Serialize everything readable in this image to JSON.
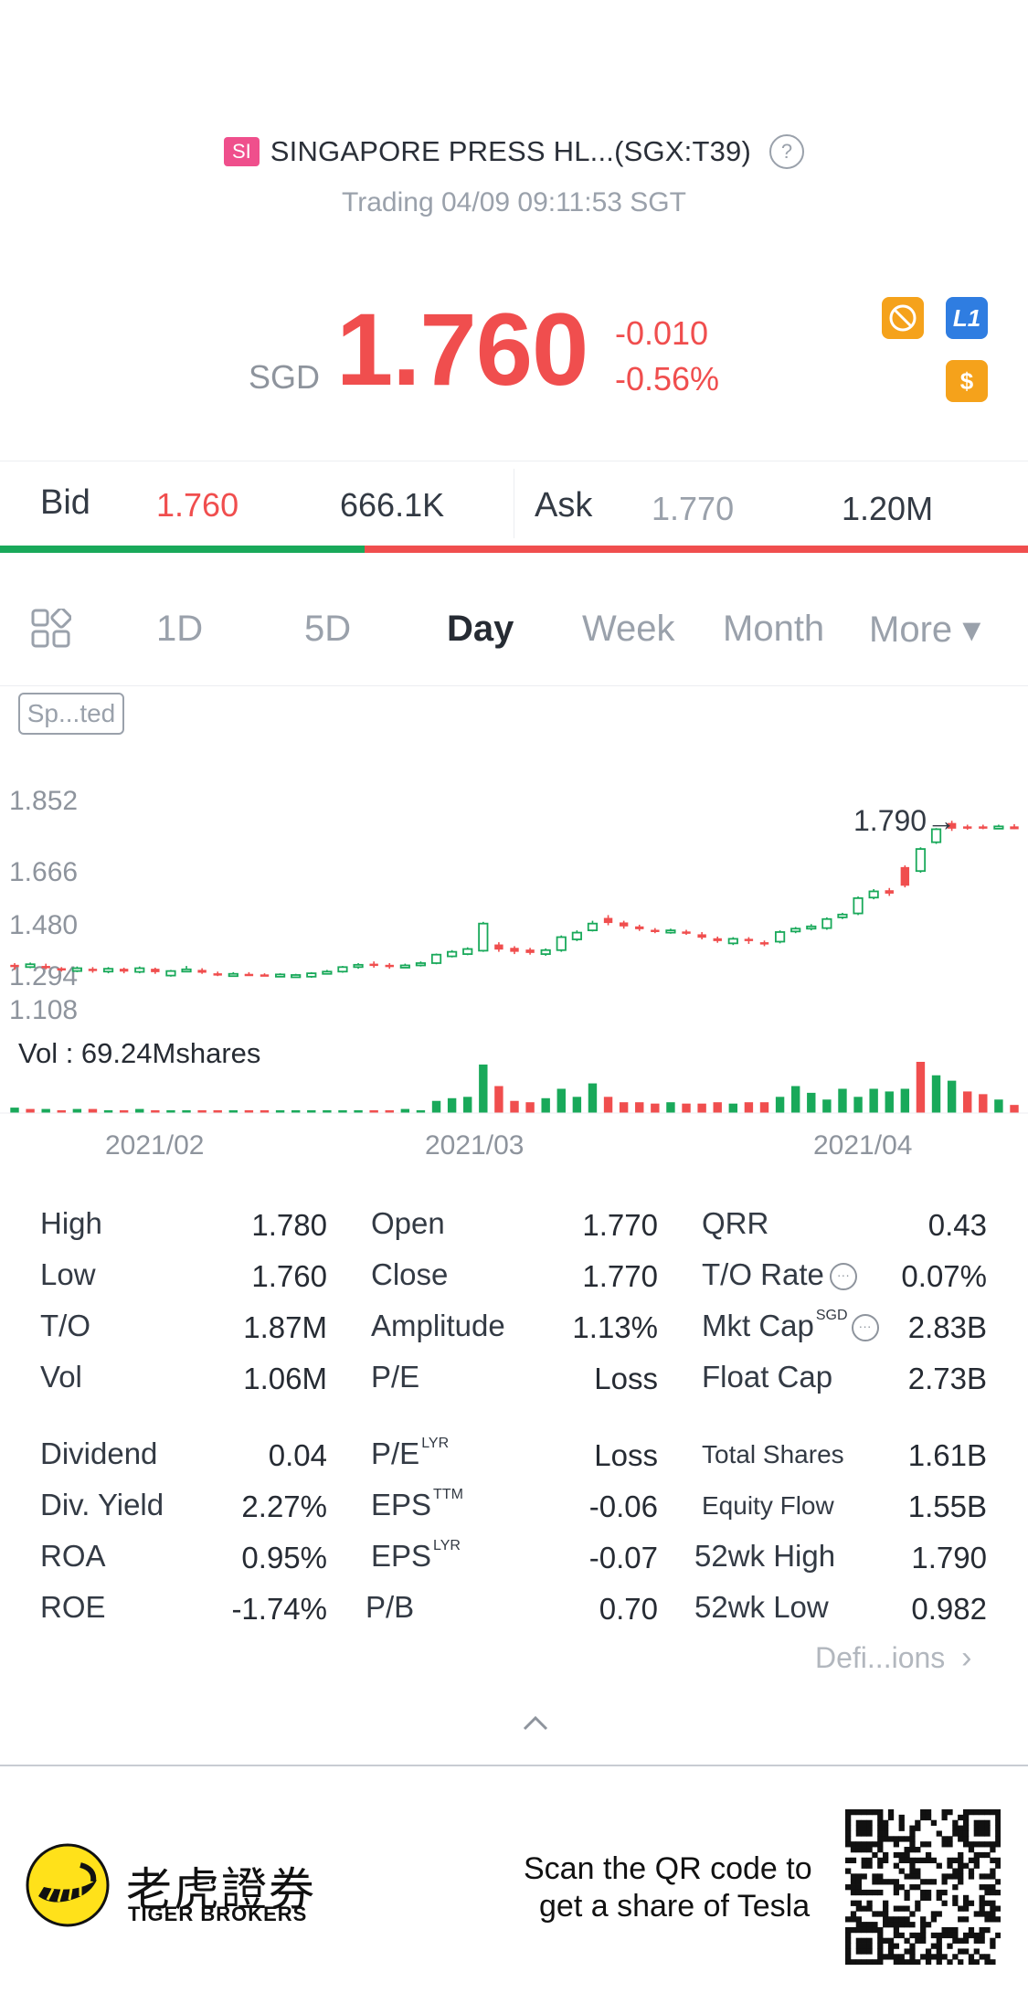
{
  "header": {
    "market_badge": "SI",
    "title": "SINGAPORE PRESS HL...(SGX:T39)",
    "status": "Trading 04/09 09:11:53 SGT"
  },
  "quote": {
    "currency": "SGD",
    "price": "1.760",
    "change": "-0.010",
    "change_pct": "-0.56%",
    "badges": {
      "l1": "L1",
      "dollar": "$"
    }
  },
  "bid_ask": {
    "bid_label": "Bid",
    "bid_price": "1.760",
    "bid_size": "666.1K",
    "ask_label": "Ask",
    "ask_price": "1.770",
    "ask_size": "1.20M",
    "bid_ratio": 0.355
  },
  "tabs": [
    {
      "label": "1D"
    },
    {
      "label": "5D"
    },
    {
      "label": "Day",
      "active": true
    },
    {
      "label": "Week"
    },
    {
      "label": "Month"
    },
    {
      "label": "More ▾"
    }
  ],
  "chart_controls": {
    "split_label": "Sp...ted"
  },
  "chart_data": {
    "type": "candlestick",
    "price_ticks": [
      "1.852",
      "1.666",
      "1.480",
      "1.294",
      "1.108"
    ],
    "ylim": [
      1.108,
      1.852
    ],
    "last_marker": "1.790",
    "x_ticks": [
      "2021/02",
      "2021/03",
      "2021/04"
    ],
    "volume_label": "Vol  : 69.24Mshares",
    "up_color": "#19a95a",
    "down_color": "#f04e4e",
    "candles": [
      {
        "o": 1.28,
        "c": 1.272,
        "h": 1.286,
        "l": 1.262
      },
      {
        "o": 1.272,
        "c": 1.282,
        "h": 1.288,
        "l": 1.268
      },
      {
        "o": 1.276,
        "c": 1.27,
        "h": 1.284,
        "l": 1.264
      },
      {
        "o": 1.268,
        "c": 1.262,
        "h": 1.272,
        "l": 1.256
      },
      {
        "o": 1.258,
        "c": 1.268,
        "h": 1.274,
        "l": 1.254
      },
      {
        "o": 1.266,
        "c": 1.258,
        "h": 1.272,
        "l": 1.252
      },
      {
        "o": 1.256,
        "c": 1.266,
        "h": 1.272,
        "l": 1.25
      },
      {
        "o": 1.266,
        "c": 1.256,
        "h": 1.27,
        "l": 1.25
      },
      {
        "o": 1.255,
        "c": 1.268,
        "h": 1.274,
        "l": 1.25
      },
      {
        "o": 1.266,
        "c": 1.254,
        "h": 1.27,
        "l": 1.248
      },
      {
        "o": 1.242,
        "c": 1.258,
        "h": 1.262,
        "l": 1.238
      },
      {
        "o": 1.258,
        "c": 1.264,
        "h": 1.276,
        "l": 1.254
      },
      {
        "o": 1.262,
        "c": 1.252,
        "h": 1.268,
        "l": 1.248
      },
      {
        "o": 1.25,
        "c": 1.245,
        "h": 1.256,
        "l": 1.24
      },
      {
        "o": 1.244,
        "c": 1.248,
        "h": 1.254,
        "l": 1.24
      },
      {
        "o": 1.248,
        "c": 1.246,
        "h": 1.254,
        "l": 1.242
      },
      {
        "o": 1.246,
        "c": 1.244,
        "h": 1.25,
        "l": 1.24
      },
      {
        "o": 1.244,
        "c": 1.246,
        "h": 1.25,
        "l": 1.24
      },
      {
        "o": 1.242,
        "c": 1.244,
        "h": 1.248,
        "l": 1.238
      },
      {
        "o": 1.238,
        "c": 1.25,
        "h": 1.254,
        "l": 1.234
      },
      {
        "o": 1.25,
        "c": 1.256,
        "h": 1.262,
        "l": 1.246
      },
      {
        "o": 1.256,
        "c": 1.272,
        "h": 1.276,
        "l": 1.252
      },
      {
        "o": 1.272,
        "c": 1.28,
        "h": 1.286,
        "l": 1.266
      },
      {
        "o": 1.284,
        "c": 1.276,
        "h": 1.292,
        "l": 1.27
      },
      {
        "o": 1.28,
        "c": 1.272,
        "h": 1.286,
        "l": 1.266
      },
      {
        "o": 1.274,
        "c": 1.278,
        "h": 1.284,
        "l": 1.268
      },
      {
        "o": 1.278,
        "c": 1.286,
        "h": 1.292,
        "l": 1.274
      },
      {
        "o": 1.286,
        "c": 1.316,
        "h": 1.32,
        "l": 1.282
      },
      {
        "o": 1.31,
        "c": 1.326,
        "h": 1.332,
        "l": 1.306
      },
      {
        "o": 1.318,
        "c": 1.336,
        "h": 1.342,
        "l": 1.314
      },
      {
        "o": 1.33,
        "c": 1.426,
        "h": 1.432,
        "l": 1.326
      },
      {
        "o": 1.352,
        "c": 1.334,
        "h": 1.36,
        "l": 1.326
      },
      {
        "o": 1.34,
        "c": 1.326,
        "h": 1.346,
        "l": 1.318
      },
      {
        "o": 1.334,
        "c": 1.322,
        "h": 1.34,
        "l": 1.316
      },
      {
        "o": 1.318,
        "c": 1.332,
        "h": 1.338,
        "l": 1.312
      },
      {
        "o": 1.332,
        "c": 1.378,
        "h": 1.384,
        "l": 1.326
      },
      {
        "o": 1.37,
        "c": 1.394,
        "h": 1.402,
        "l": 1.364
      },
      {
        "o": 1.402,
        "c": 1.426,
        "h": 1.436,
        "l": 1.398
      },
      {
        "o": 1.446,
        "c": 1.428,
        "h": 1.456,
        "l": 1.42
      },
      {
        "o": 1.43,
        "c": 1.416,
        "h": 1.436,
        "l": 1.408
      },
      {
        "o": 1.416,
        "c": 1.406,
        "h": 1.422,
        "l": 1.4
      },
      {
        "o": 1.404,
        "c": 1.398,
        "h": 1.41,
        "l": 1.392
      },
      {
        "o": 1.396,
        "c": 1.402,
        "h": 1.408,
        "l": 1.39
      },
      {
        "o": 1.398,
        "c": 1.392,
        "h": 1.404,
        "l": 1.386
      },
      {
        "o": 1.388,
        "c": 1.376,
        "h": 1.396,
        "l": 1.37
      },
      {
        "o": 1.374,
        "c": 1.364,
        "h": 1.38,
        "l": 1.358
      },
      {
        "o": 1.356,
        "c": 1.372,
        "h": 1.378,
        "l": 1.35
      },
      {
        "o": 1.372,
        "c": 1.364,
        "h": 1.378,
        "l": 1.354
      },
      {
        "o": 1.36,
        "c": 1.352,
        "h": 1.366,
        "l": 1.346
      },
      {
        "o": 1.362,
        "c": 1.396,
        "h": 1.402,
        "l": 1.356
      },
      {
        "o": 1.398,
        "c": 1.408,
        "h": 1.414,
        "l": 1.392
      },
      {
        "o": 1.408,
        "c": 1.416,
        "h": 1.424,
        "l": 1.402
      },
      {
        "o": 1.41,
        "c": 1.442,
        "h": 1.448,
        "l": 1.404
      },
      {
        "o": 1.448,
        "c": 1.458,
        "h": 1.464,
        "l": 1.442
      },
      {
        "o": 1.462,
        "c": 1.516,
        "h": 1.522,
        "l": 1.456
      },
      {
        "o": 1.518,
        "c": 1.54,
        "h": 1.548,
        "l": 1.512
      },
      {
        "o": 1.544,
        "c": 1.532,
        "h": 1.552,
        "l": 1.524
      },
      {
        "o": 1.626,
        "c": 1.56,
        "h": 1.632,
        "l": 1.554
      },
      {
        "o": 1.612,
        "c": 1.69,
        "h": 1.696,
        "l": 1.606
      },
      {
        "o": 1.714,
        "c": 1.76,
        "h": 1.764,
        "l": 1.708
      },
      {
        "o": 1.782,
        "c": 1.762,
        "h": 1.79,
        "l": 1.754
      },
      {
        "o": 1.77,
        "c": 1.764,
        "h": 1.776,
        "l": 1.758
      },
      {
        "o": 1.77,
        "c": 1.764,
        "h": 1.776,
        "l": 1.76
      },
      {
        "o": 1.766,
        "c": 1.77,
        "h": 1.776,
        "l": 1.762
      },
      {
        "o": 1.77,
        "c": 1.76,
        "h": 1.778,
        "l": 1.76
      }
    ],
    "volumes": [
      4,
      3,
      3,
      2,
      3,
      3,
      2,
      2,
      3,
      2,
      2,
      2,
      2,
      2,
      2,
      2,
      1,
      1,
      1,
      1,
      2,
      2,
      2,
      2,
      2,
      3,
      2,
      9,
      11,
      12,
      36,
      20,
      9,
      8,
      11,
      18,
      12,
      22,
      12,
      8,
      8,
      7,
      8,
      7,
      7,
      8,
      7,
      8,
      8,
      12,
      20,
      15,
      10,
      18,
      12,
      18,
      16,
      18,
      38,
      28,
      24,
      16,
      14,
      10,
      6
    ],
    "volume_up": [
      true,
      false,
      true,
      false,
      true,
      false,
      true,
      false,
      true,
      false,
      true,
      true,
      false,
      false,
      true,
      false,
      false,
      true,
      true,
      true,
      true,
      true,
      true,
      false,
      false,
      true,
      true,
      true,
      true,
      true,
      true,
      false,
      false,
      false,
      true,
      true,
      true,
      true,
      false,
      false,
      false,
      false,
      true,
      false,
      false,
      false,
      true,
      false,
      false,
      true,
      true,
      true,
      true,
      true,
      true,
      true,
      true,
      true,
      false,
      true,
      true,
      false,
      false,
      true,
      false
    ]
  },
  "stats": {
    "col1": [
      {
        "label": "High",
        "value": "1.780"
      },
      {
        "label": "Low",
        "value": "1.760"
      },
      {
        "label": "T/O",
        "value": "1.87M"
      },
      {
        "label": "Vol",
        "value": "1.06M"
      },
      {
        "label": "Dividend",
        "value": "0.04"
      },
      {
        "label": "Div. Yield",
        "value": "2.27%"
      },
      {
        "label": "ROA",
        "value": "0.95%"
      },
      {
        "label": "ROE",
        "value": "-1.74%"
      }
    ],
    "col2": [
      {
        "label": "Open",
        "value": "1.770"
      },
      {
        "label": "Close",
        "value": "1.770"
      },
      {
        "label": "Amplitude",
        "value": "1.13%"
      },
      {
        "label": "P/E",
        "value": "Loss"
      },
      {
        "label": "P/E",
        "sup": "LYR",
        "value": "Loss"
      },
      {
        "label": "EPS",
        "sup": "TTM",
        "value": "-0.06"
      },
      {
        "label": "EPS",
        "sup": "LYR",
        "value": "-0.07"
      },
      {
        "label": "P/B",
        "value": "0.70"
      }
    ],
    "col3": [
      {
        "label": "QRR",
        "value": "0.43"
      },
      {
        "label": "T/O Rate",
        "value": "0.07%"
      },
      {
        "label": "Mkt Cap",
        "sup": "SGD",
        "value": "2.83B"
      },
      {
        "label": "Float Cap",
        "value": "2.73B"
      },
      {
        "label": "Total Shares",
        "value": "1.61B"
      },
      {
        "label": "Equity Flow",
        "value": "1.55B"
      },
      {
        "label": "52wk High",
        "value": "1.790"
      },
      {
        "label": "52wk Low",
        "value": "0.982"
      }
    ],
    "definitions_link": "Defi...ions"
  },
  "footer": {
    "brand_cn": "老虎證券",
    "brand_en": "TIGER BROKERS",
    "promo_line1": "Scan the QR code to",
    "promo_line2": "get a share of Tesla"
  }
}
